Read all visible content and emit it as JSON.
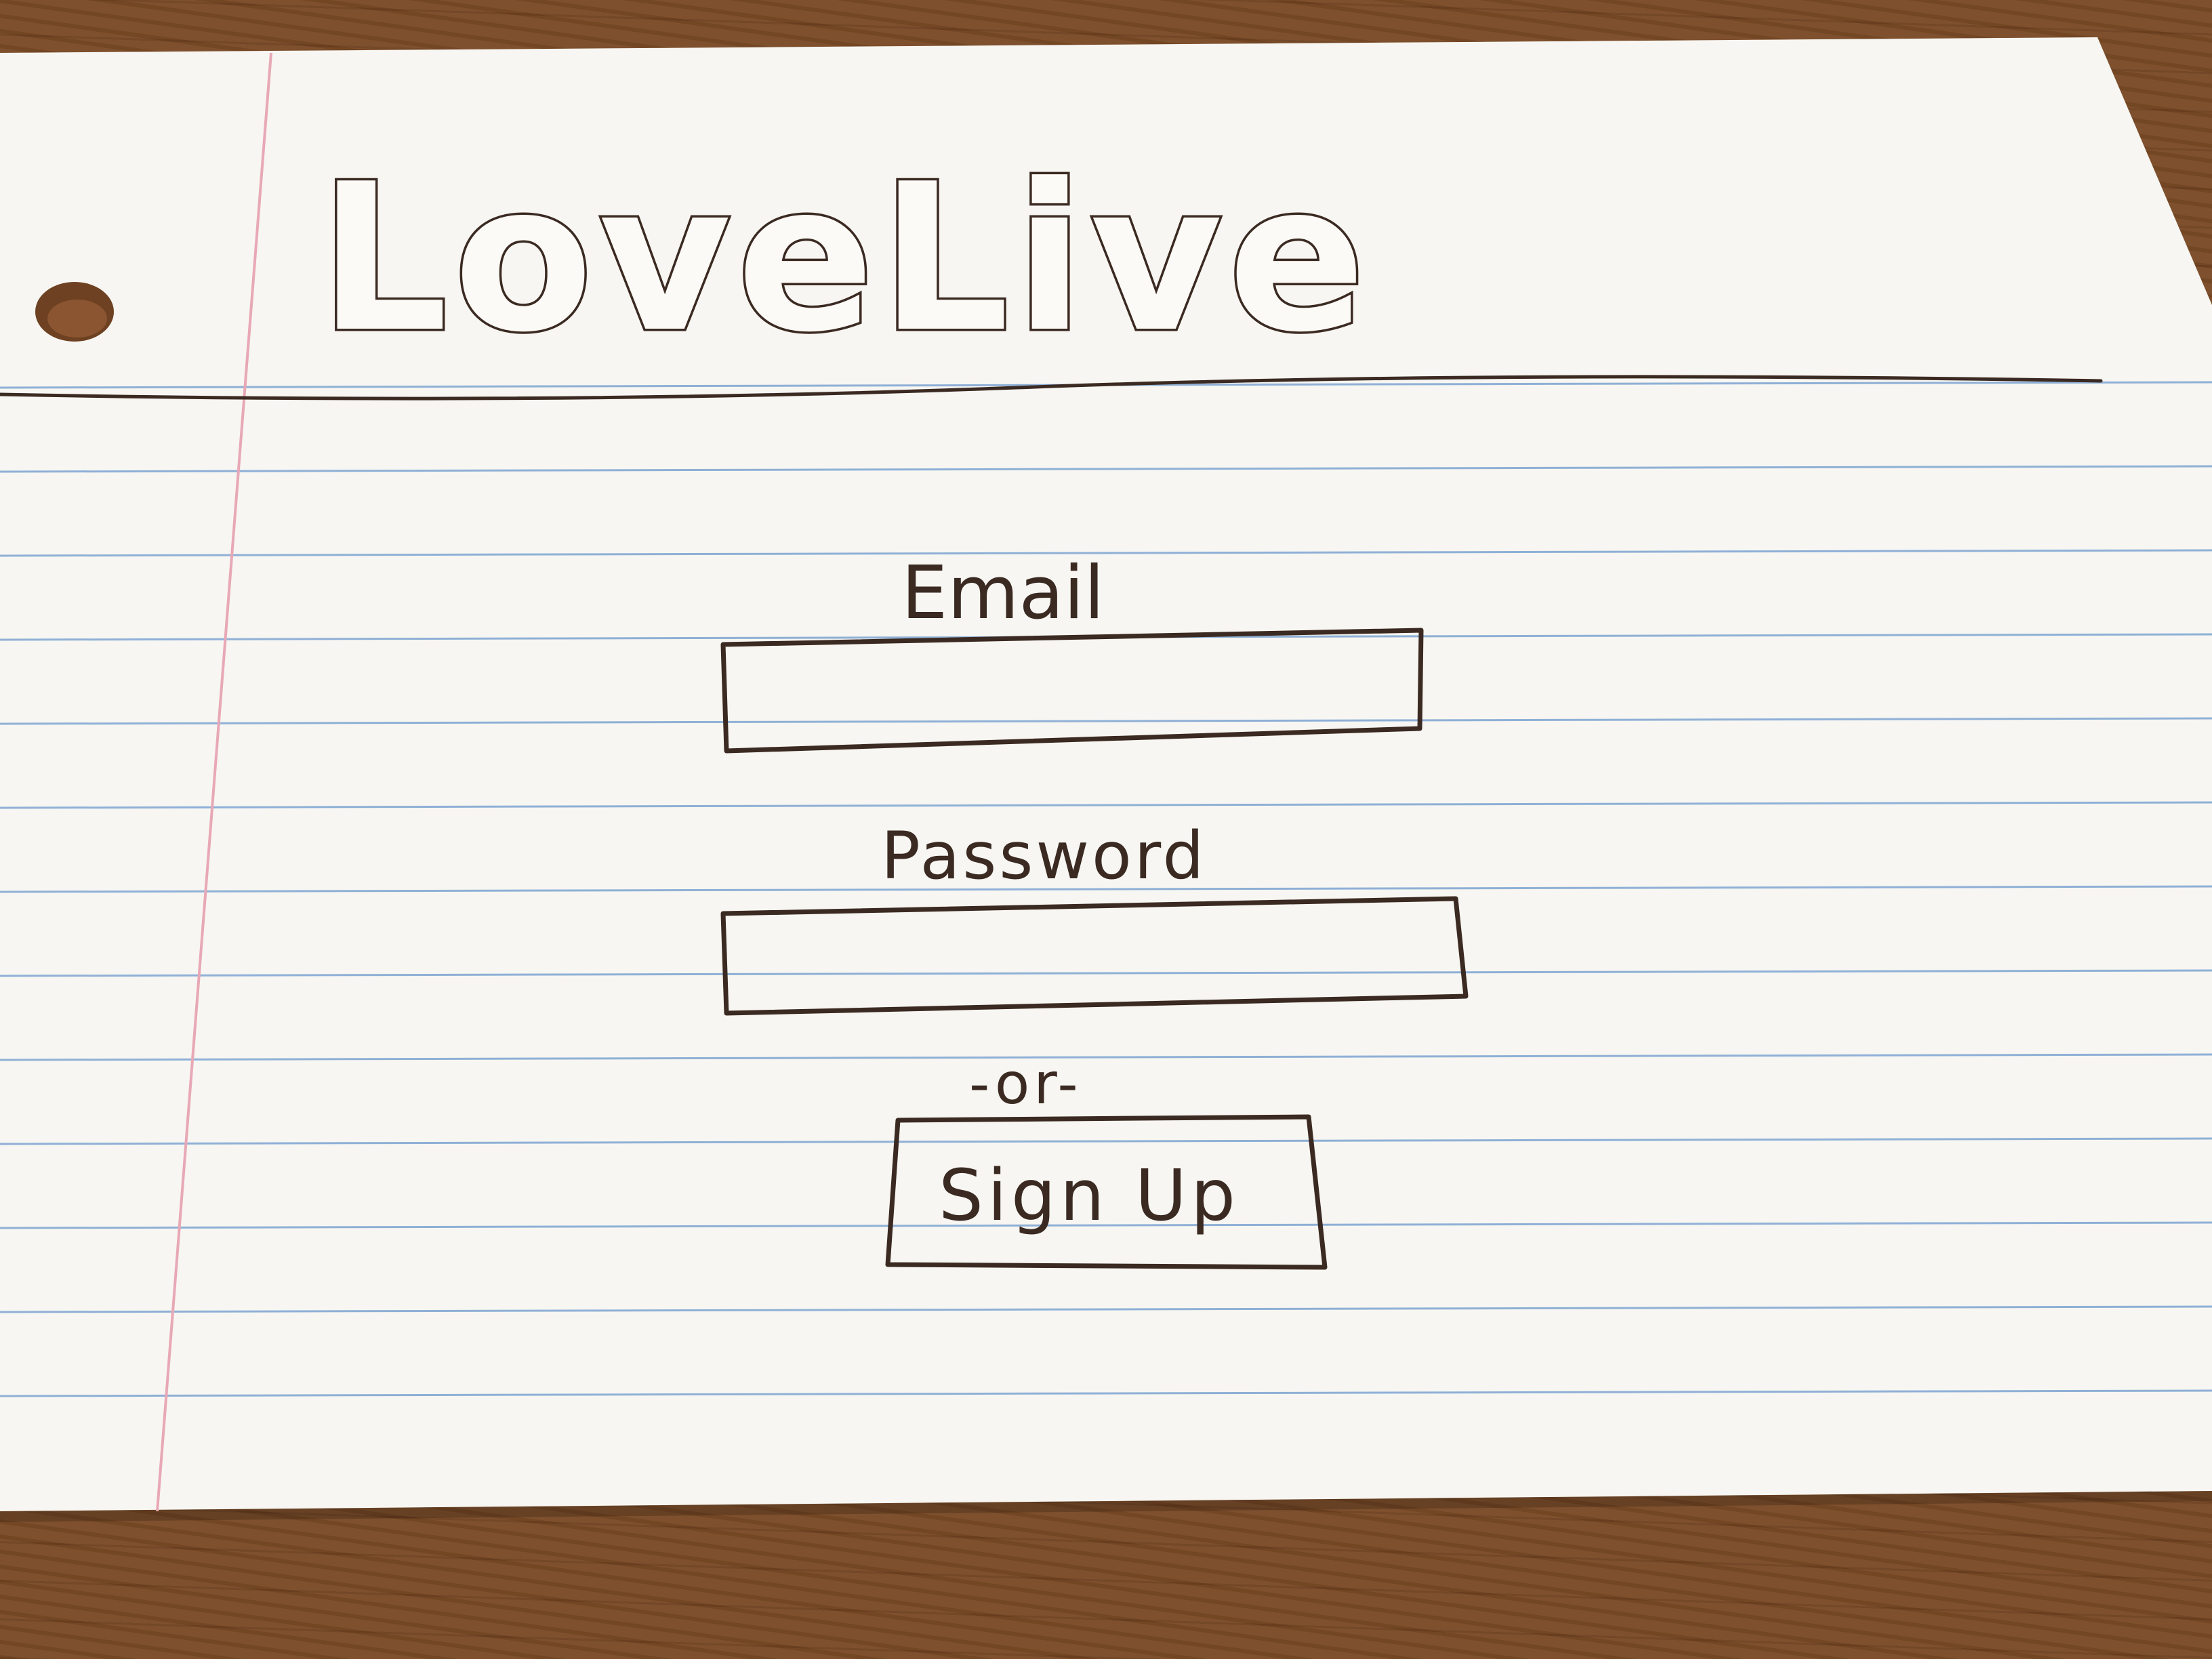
{
  "app": {
    "logo_text": "LoveLive"
  },
  "login_form": {
    "email_label": "Email",
    "email_value": "",
    "password_label": "Password",
    "password_value": "",
    "divider_text": "-or-",
    "signup_label": "Sign Up"
  },
  "colors": {
    "ink": "#3b2a22",
    "paper": "#f7f6f2",
    "rule_line": "#8fb0d6",
    "margin_line": "#e8a8b6",
    "table_wood": "#7a4a26"
  },
  "icons": {
    "binder_hole": "binder-hole-icon"
  }
}
